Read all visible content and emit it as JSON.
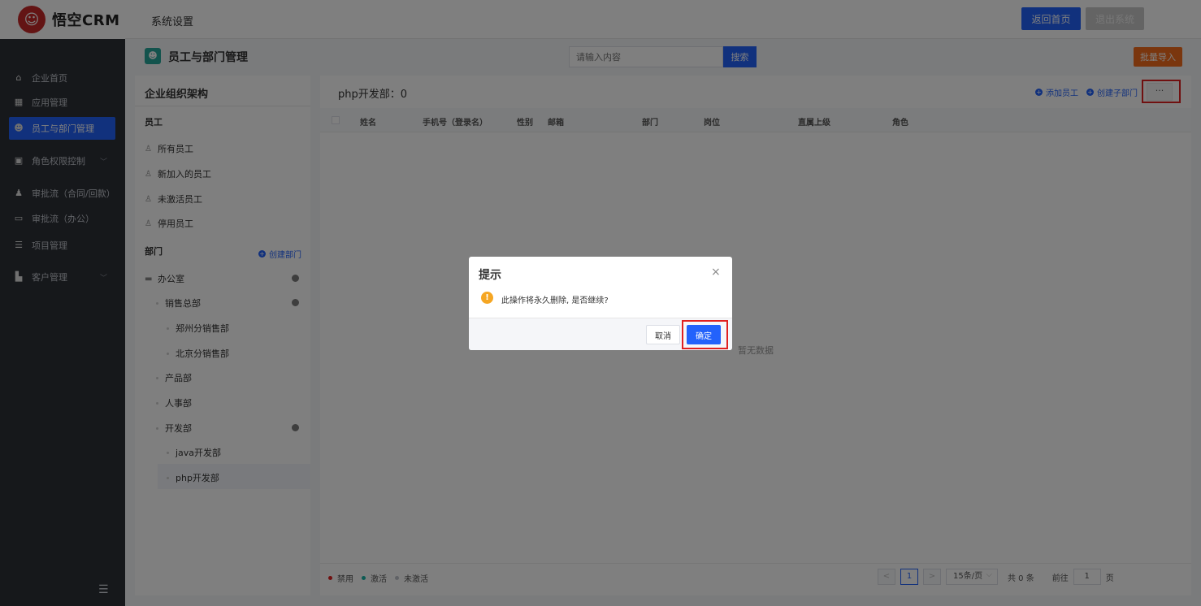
{
  "app": {
    "logo_text": "悟空CRM",
    "logo_glyph": "☺",
    "system_title": "系统设置"
  },
  "topbar": {
    "home_label": "返回首页",
    "exit_label": "退出系统"
  },
  "sidebar": {
    "items": [
      {
        "label": "企业首页",
        "icon": "home-icon"
      },
      {
        "label": "应用管理",
        "icon": "apps-icon"
      },
      {
        "label": "员工与部门管理",
        "icon": "users-icon"
      },
      {
        "label": "角色权限控制",
        "icon": "role-icon"
      },
      {
        "label": "审批流（合同/回款）",
        "icon": "approval-icon"
      },
      {
        "label": "审批流（办公）",
        "icon": "monitor-icon"
      },
      {
        "label": "项目管理",
        "icon": "project-icon"
      },
      {
        "label": "客户管理",
        "icon": "customer-icon"
      }
    ]
  },
  "page": {
    "title": "员工与部门管理",
    "search_placeholder": "请输入内容",
    "search_label": "搜索",
    "import_label": "批量导入"
  },
  "org": {
    "title": "企业组织架构",
    "employees_section": "员工",
    "employee_filters": [
      "所有员工",
      "新加入的员工",
      "未激活员工",
      "停用员工"
    ],
    "dept_section": "部门",
    "create_dept_label": "创建部门",
    "tree": [
      {
        "label": "办公室",
        "level": 0
      },
      {
        "label": "销售总部",
        "level": 1
      },
      {
        "label": "郑州分销售部",
        "level": 2
      },
      {
        "label": "北京分销售部",
        "level": 2
      },
      {
        "label": "产品部",
        "level": 1
      },
      {
        "label": "人事部",
        "level": 1
      },
      {
        "label": "开发部",
        "level": 1
      },
      {
        "label": "java开发部",
        "level": 2
      },
      {
        "label": "php开发部",
        "level": 2
      }
    ]
  },
  "main": {
    "dept_title": "php开发部：0",
    "add_employee_label": "添加员工",
    "create_sub_dept_label": "创建子部门",
    "more_label": "···",
    "columns": [
      "姓名",
      "手机号（登录名）",
      "性别",
      "邮箱",
      "部门",
      "岗位",
      "直属上级",
      "角色"
    ],
    "empty_text": "暂无数据",
    "legend": [
      {
        "label": "禁用",
        "color": "#e02020"
      },
      {
        "label": "激活",
        "color": "#19b5a6"
      },
      {
        "label": "未激活",
        "color": "#c0c4cc"
      }
    ],
    "pager": {
      "prev": "<",
      "current": "1",
      "next": ">",
      "page_size": "15条/页",
      "total": "共 0 条",
      "goto_label": "前往",
      "goto_value": "1",
      "page_suffix": "页"
    }
  },
  "dialog": {
    "title": "提示",
    "close": "×",
    "warn_glyph": "!",
    "message": "此操作将永久删除, 是否继续?",
    "cancel_label": "取消",
    "confirm_label": "确定"
  },
  "colors": {
    "primary": "#2362fb",
    "sidebar_bg": "#2d3037",
    "warn": "#f5a623",
    "highlight": "#e02020",
    "import": "#f46c1c"
  }
}
